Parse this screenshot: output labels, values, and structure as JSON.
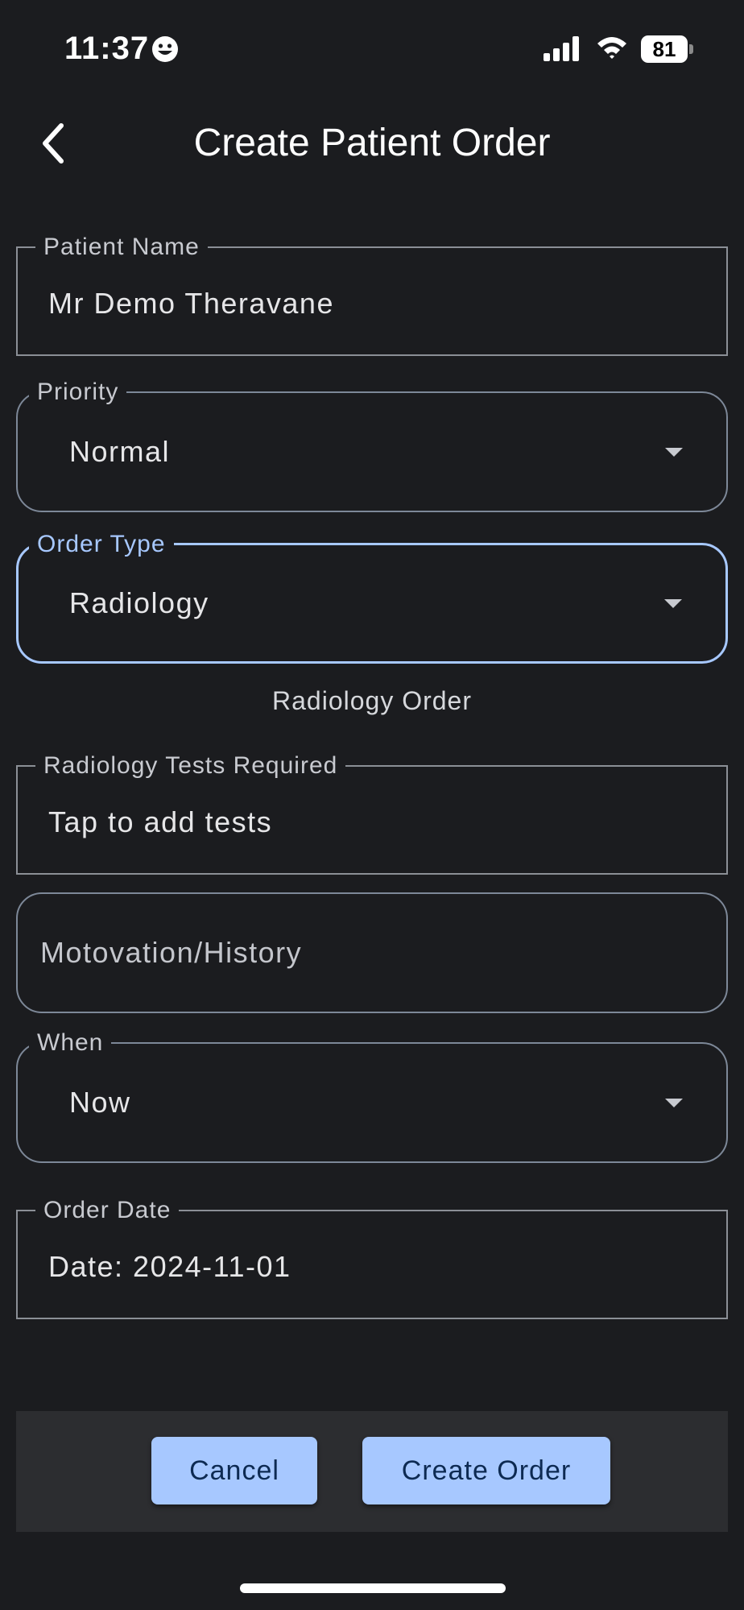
{
  "status_bar": {
    "time": "11:37",
    "battery": "81",
    "icons": [
      "smile-icon",
      "signal-icon",
      "wifi-icon",
      "battery-icon"
    ]
  },
  "header": {
    "title": "Create Patient Order",
    "back_icon": "chevron-left-icon"
  },
  "form": {
    "patient_name": {
      "label": "Patient Name",
      "value": "Mr Demo Theravane"
    },
    "priority": {
      "label": "Priority",
      "value": "Normal"
    },
    "order_type": {
      "label": "Order Type",
      "value": "Radiology"
    },
    "order_subtitle": "Radiology Order",
    "tests": {
      "label": "Radiology Tests Required",
      "value": "Tap to add tests"
    },
    "motivation": {
      "placeholder": "Motovation/History"
    },
    "when": {
      "label": "When",
      "value": "Now"
    },
    "order_date": {
      "label": "Order Date",
      "value": "Date: 2024-11-01"
    }
  },
  "actions": {
    "cancel": "Cancel",
    "create": "Create Order"
  },
  "colors": {
    "background": "#1b1c1f",
    "accent": "#a7c8ff",
    "button_text": "#0d2a52",
    "action_bar": "#2c2d30"
  }
}
